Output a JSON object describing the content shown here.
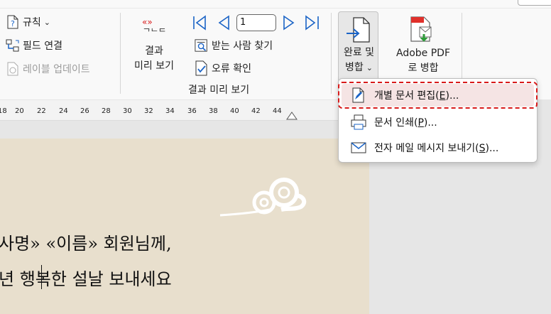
{
  "ribbon": {
    "rules_label": "규칙",
    "match_fields_label": "필드 연결",
    "update_labels_label": "레이블 업데이트",
    "preview_results": {
      "line1": "결과",
      "line2": "미리 보기"
    },
    "record_number": "1",
    "find_recipient_label": "받는 사람 찾기",
    "check_errors_label": "오류 확인",
    "preview_group_label": "결과 미리 보기",
    "finish_merge": {
      "line1": "완료 및",
      "line2": "병합"
    },
    "adobe_pdf_merge": {
      "line1": "Adobe PDF",
      "line2": "로 병합"
    }
  },
  "ruler": {
    "numbers": [
      "18",
      "20",
      "22",
      "24",
      "26",
      "28",
      "30",
      "32",
      "34",
      "36",
      "38",
      "40",
      "42",
      "44"
    ]
  },
  "document": {
    "line1": "사명» «이름» 회원님께,",
    "line2": "년 행복한 설날 보내세요"
  },
  "menu": {
    "edit_individual": {
      "text": "개별 문서 편집(",
      "key": "E",
      "tail": ")..."
    },
    "print_documents": {
      "text": "문서 인쇄(",
      "key": "P",
      "tail": ")..."
    },
    "send_email": {
      "text": "전자 메일 메시지 보내기(",
      "key": "S",
      "tail": ")..."
    }
  },
  "colors": {
    "accent_blue": "#1a63c6",
    "highlight_red": "#d81b1b",
    "page_background": "#e8dfcd"
  }
}
